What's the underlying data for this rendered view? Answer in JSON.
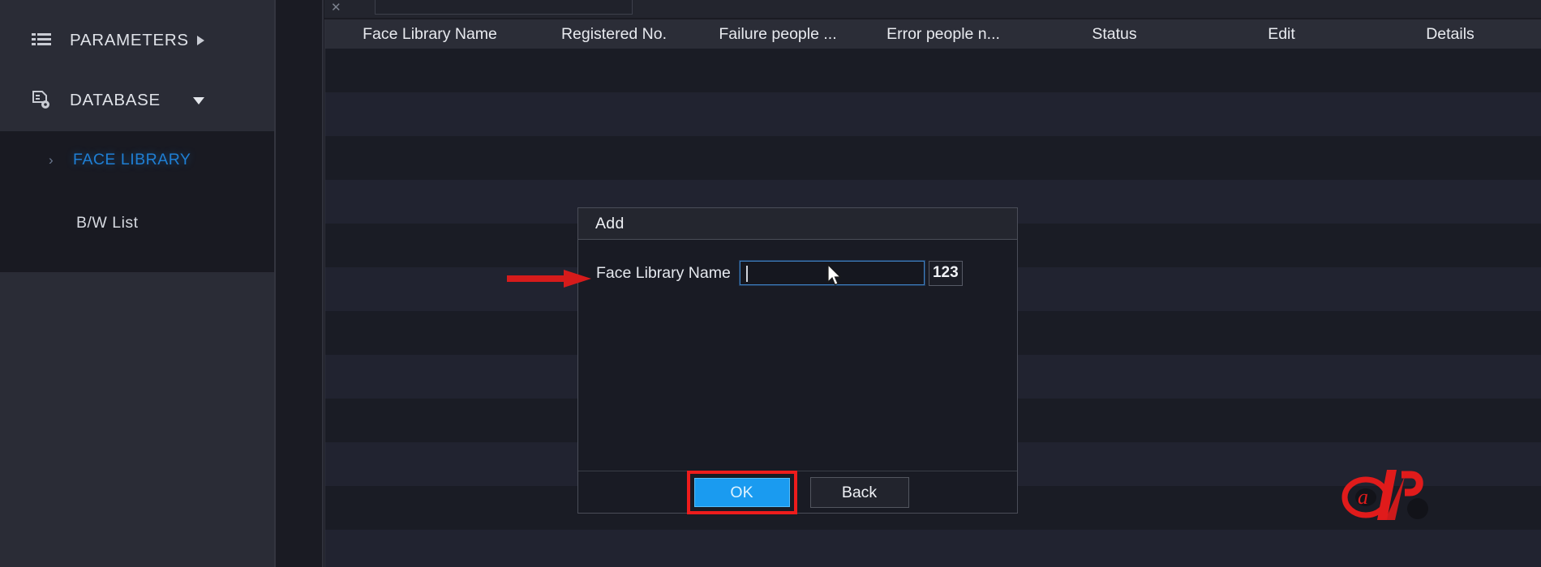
{
  "sidebar": {
    "nav": [
      {
        "label": "PARAMETERS",
        "icon": "list-icon",
        "arrow": "chevron-right-icon",
        "expanded": false
      },
      {
        "label": "DATABASE",
        "icon": "database-document-icon",
        "arrow": "chevron-down-icon",
        "expanded": true
      }
    ],
    "submenu": [
      {
        "label": "FACE LIBRARY",
        "active": true,
        "chevron": "›"
      },
      {
        "label": "B/W List",
        "active": false,
        "chevron": ""
      }
    ]
  },
  "main": {
    "table": {
      "columns": [
        "Face Library Name",
        "Registered No.",
        "Failure people ...",
        "Error people n...",
        "Status",
        "Edit",
        "Details"
      ],
      "rows": []
    }
  },
  "dialog": {
    "title": "Add",
    "field": {
      "label": "Face Library Name",
      "value": "",
      "placeholder": ""
    },
    "ime_button": "123",
    "buttons": {
      "ok": "OK",
      "back": "Back"
    }
  },
  "annotations": {
    "arrow_color": "#d61b1b",
    "highlight_color": "#ee1c1c",
    "accent_blue": "#1a9bf0",
    "active_link": "#1f7fd4"
  },
  "watermark": {
    "name": "alp-logo",
    "color": "#e01b1b"
  }
}
